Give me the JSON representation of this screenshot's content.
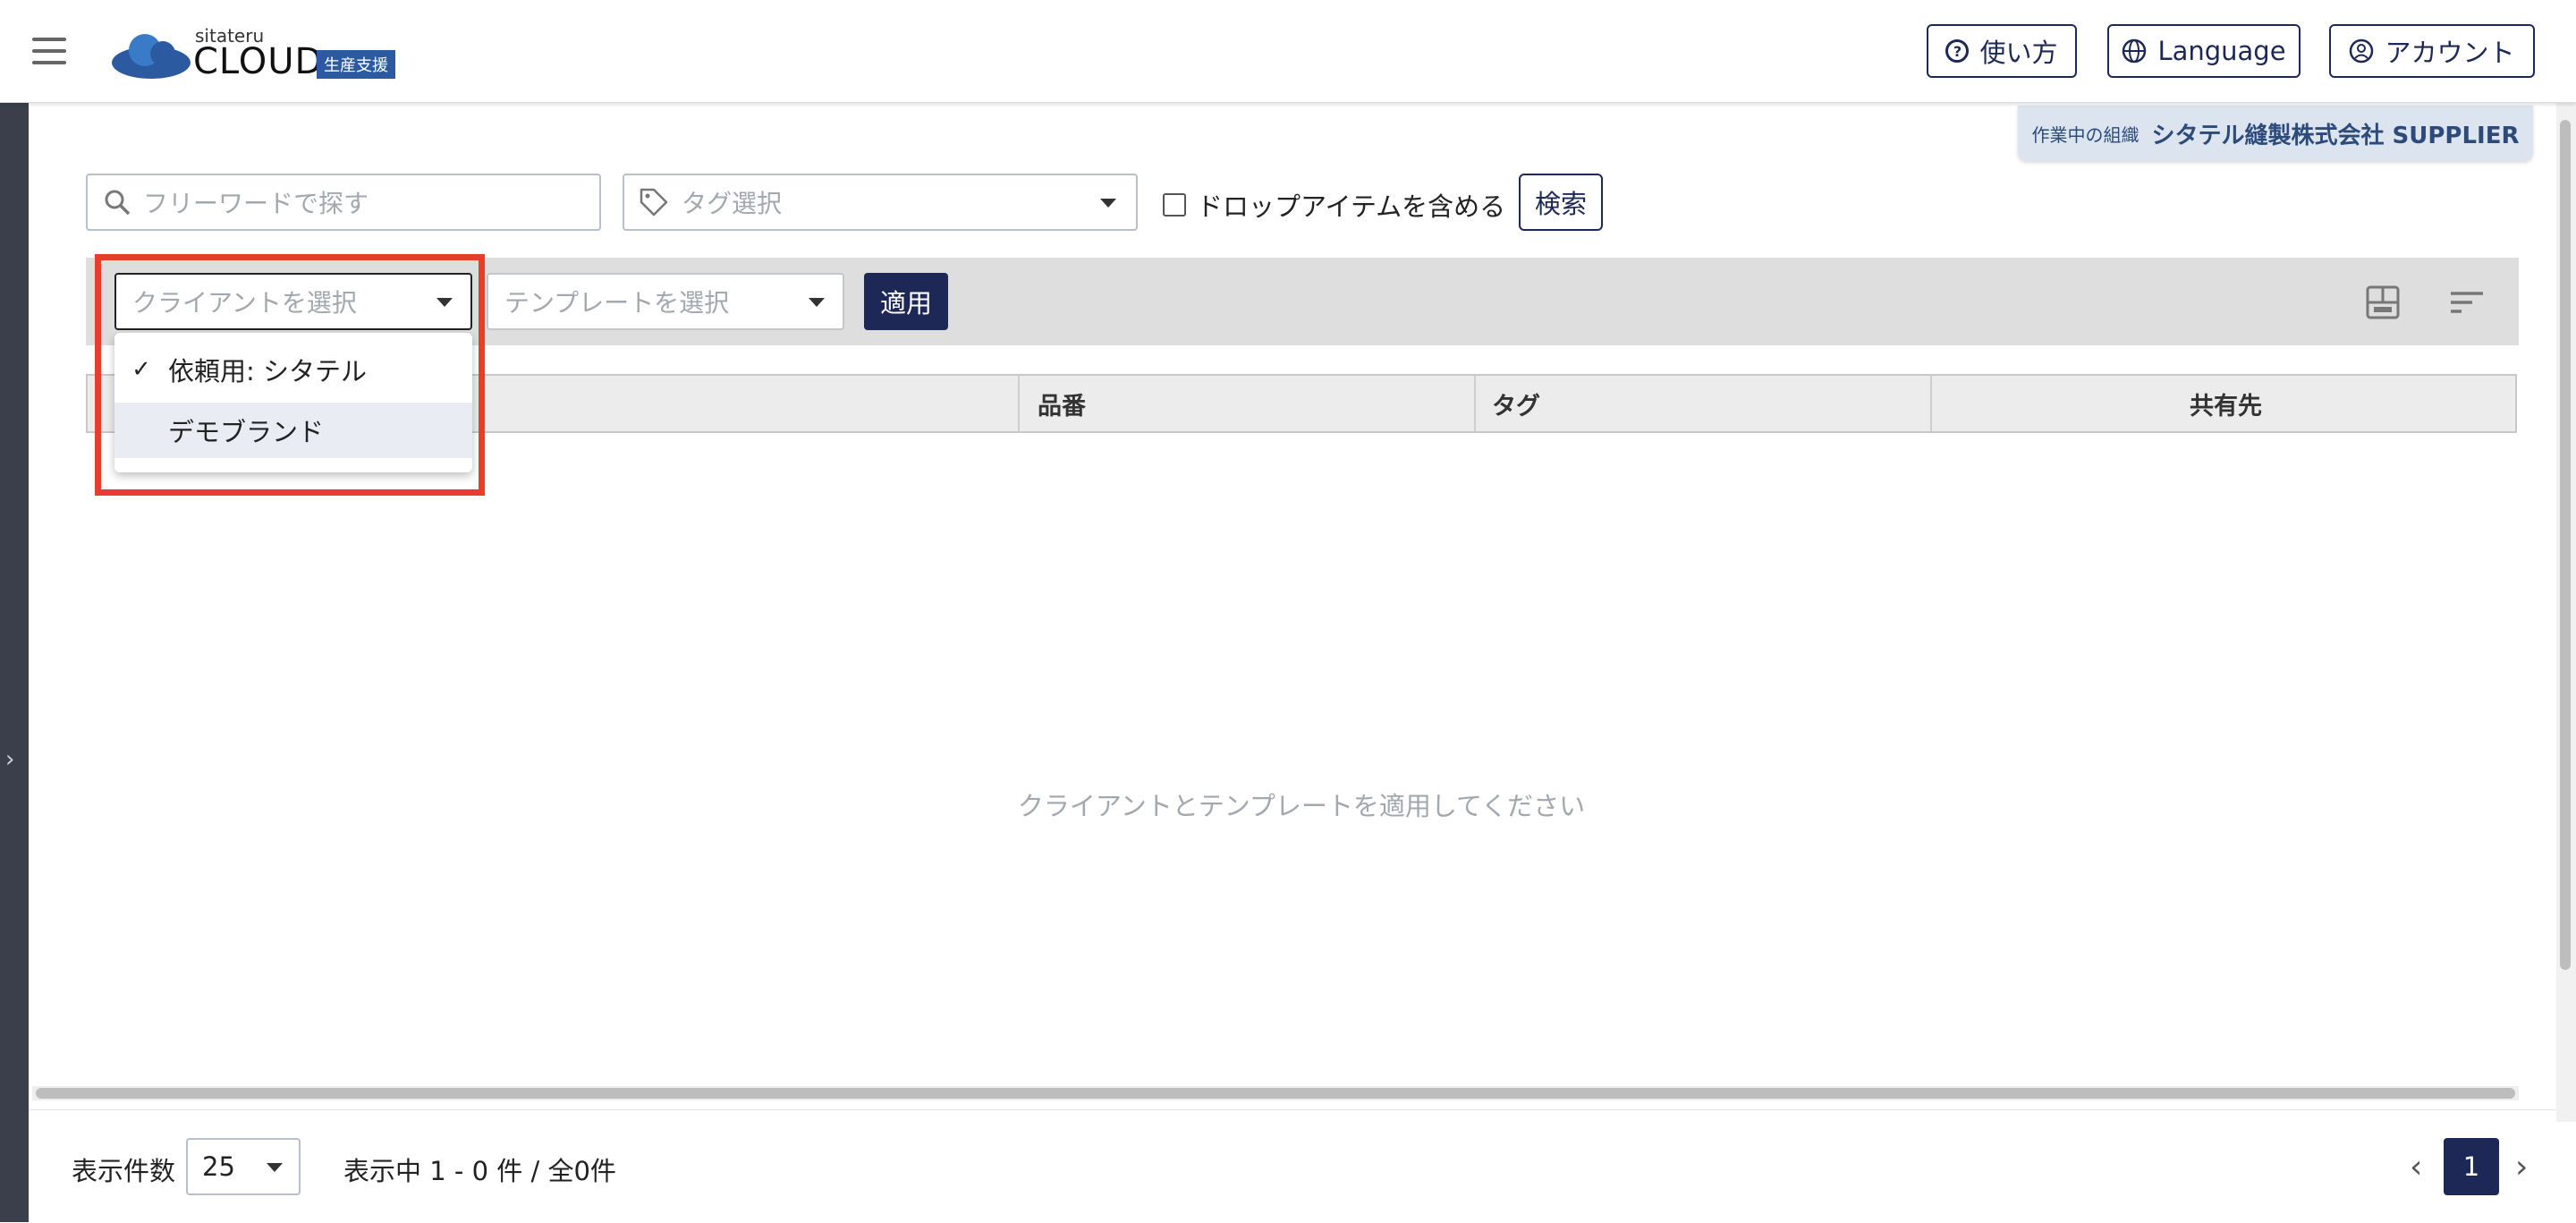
{
  "brand": {
    "logo_small": "sitateru",
    "logo_main": "CLOUD",
    "logo_badge": "生産支援"
  },
  "header": {
    "help_label": "使い方",
    "language_label": "Language",
    "account_label": "アカウント"
  },
  "org": {
    "label": "作業中の組織",
    "name": "シタテル縫製株式会社 SUPPLIER"
  },
  "filters": {
    "search_placeholder": "フリーワードで探す",
    "tag_placeholder": "タグ選択",
    "drop_items_label": "ドロップアイテムを含める",
    "drop_items_checked": false,
    "search_button": "検索"
  },
  "toolbar": {
    "client_placeholder": "クライアントを選択",
    "template_placeholder": "テンプレートを選択",
    "apply_button": "適用"
  },
  "client_dropdown": {
    "options": [
      {
        "label": "依頼用: シタテル",
        "checked": true
      },
      {
        "label": "デモブランド",
        "checked": false
      }
    ]
  },
  "table": {
    "columns": [
      "",
      "品番",
      "タグ",
      "共有先"
    ],
    "empty_message": "クライアントとテンプレートを適用してください"
  },
  "footer": {
    "per_page_label": "表示件数",
    "per_page_value": "25",
    "range_text": "表示中 1 - 0 件 / 全0件",
    "current_page": "1"
  },
  "colors": {
    "primary": "#1e2856",
    "highlight": "#e83d2a",
    "toolbar_bg": "#dedede",
    "org_bg": "#dbe4ef"
  }
}
